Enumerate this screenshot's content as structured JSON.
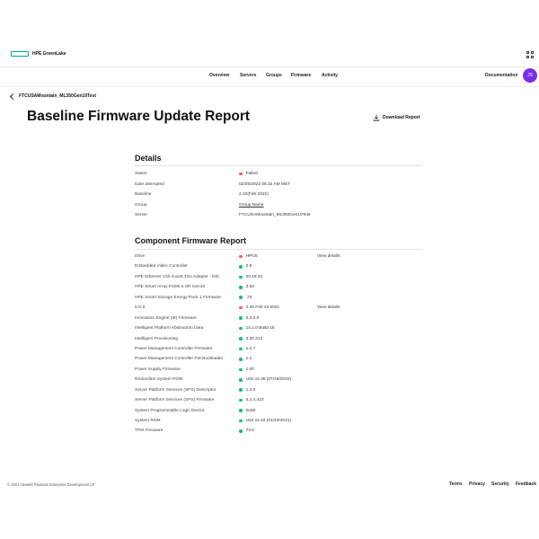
{
  "header": {
    "brand": "HPE GreenLake",
    "nav": [
      "Overview",
      "Servers",
      "Groups",
      "Firmware",
      "Activity"
    ],
    "documentation": "Documentation",
    "avatar_initials": "JS"
  },
  "breadcrumb": "FTCUSAMountain_ML350Gen10Test",
  "page": {
    "title": "Baseline Firmware Update Report",
    "download": "Download Report"
  },
  "details": {
    "title": "Details",
    "rows": [
      {
        "label": "Status",
        "value": "Failed",
        "status": "fail"
      },
      {
        "label": "Date attempted",
        "value": "02/25/2022 08:32 AM MST"
      },
      {
        "label": "Baseline",
        "value": "2.22(Feb 2022)"
      },
      {
        "label": "Group",
        "value": "Group Name",
        "link": true
      },
      {
        "label": "Server",
        "value": "FTCUSAMountain_ML350Gen10Test"
      }
    ]
  },
  "component": {
    "title": "Component Firmware Report",
    "view_details": "View details",
    "rows": [
      {
        "label": "Drive",
        "value": "HPG5",
        "status": "fail",
        "details": true
      },
      {
        "label": "Embedded Video Controller",
        "value": "2.5",
        "status": "ok"
      },
      {
        "label": "HPE Ethernet 1Gb 4-port 331i Adapter - NIC",
        "value": "20.18.31",
        "status": "ok"
      },
      {
        "label": "HPE Smart Array P408i-a SR Gen10",
        "value": "3.53",
        "status": "ok"
      },
      {
        "label": "HPE Smart Storage Energy Pack 1 Firmware",
        "value": ".70",
        "status": "ok"
      },
      {
        "label": "iLO 5",
        "value": "2.40 Feb 24 2021",
        "status": "fail",
        "details": true
      },
      {
        "label": "Innovation Engine (IE) Firmware",
        "value": "0.2.2.0",
        "status": "ok"
      },
      {
        "label": "Intelligent Platform Abstraction Data",
        "value": "14.1.0 Build 18",
        "status": "ok"
      },
      {
        "label": "Intelligent Provisioning",
        "value": "3.30.213",
        "status": "ok"
      },
      {
        "label": "Power Management Controller Firmware",
        "value": "1.0.7",
        "status": "ok"
      },
      {
        "label": "Power Management Controller FW Bootloader",
        "value": "1.1",
        "status": "ok"
      },
      {
        "label": "Power Supply Firmware",
        "value": "1.00",
        "status": "ok"
      },
      {
        "label": "Redundant System ROM",
        "value": "U32 v2.36 (07/16/2020)",
        "status": "ok"
      },
      {
        "label": "Server Platform Services (SPS) Descriptor",
        "value": "1.2 0",
        "status": "ok"
      },
      {
        "label": "Server Platform Services (SPS) Firmware",
        "value": "4.1.4.423",
        "status": "ok"
      },
      {
        "label": "System Programmable Logic Device",
        "value": "0x2E",
        "status": "ok"
      },
      {
        "label": "System ROM",
        "value": "U32 v2.42 (01/23/2021)",
        "status": "ok"
      },
      {
        "label": "TPM Firmware",
        "value": "73.0",
        "status": "ok"
      }
    ]
  },
  "footer": {
    "copyright": "© 2021 Hewlett Packard Enterprise Development LP",
    "links": [
      "Terms",
      "Privacy",
      "Security",
      "Feedback"
    ]
  },
  "colors": {
    "ok": "#17b890",
    "fail": "#fc5a5a",
    "brand": "#01a982",
    "avatar": "#7630ea"
  }
}
